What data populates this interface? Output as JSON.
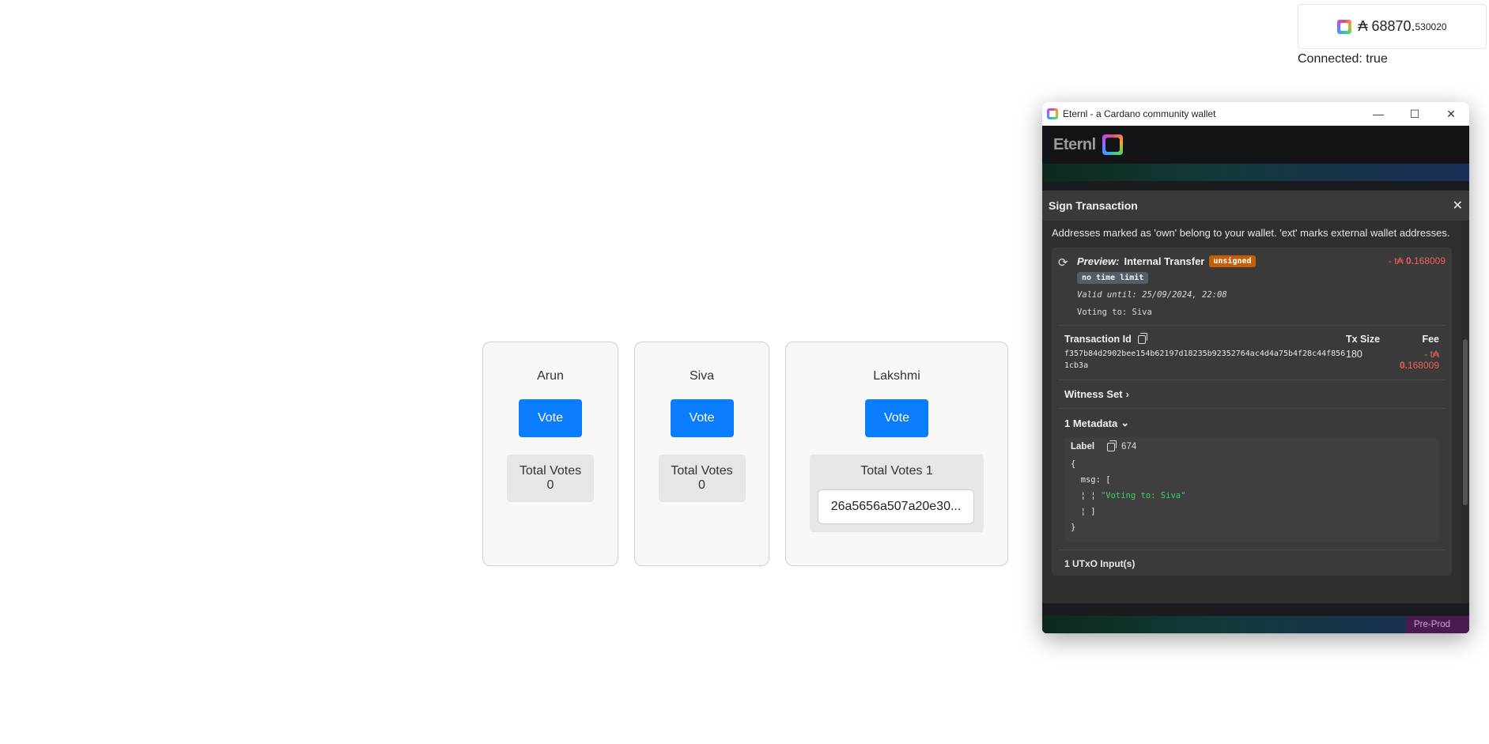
{
  "wallet_badge": {
    "balance_main": "₳ 68870.",
    "balance_small": "530020",
    "icon": "eternl-logo-icon"
  },
  "connection": {
    "status": "Connected: true"
  },
  "candidates": [
    {
      "name": "Arun",
      "vote_label": "Vote",
      "total_votes": "Total Votes 0"
    },
    {
      "name": "Siva",
      "vote_label": "Vote",
      "total_votes": "Total Votes 0"
    },
    {
      "name": "Lakshmi",
      "vote_label": "Vote",
      "total_votes": "Total Votes 1",
      "voter_hash": "26a5656a507a20e30..."
    }
  ],
  "wallet_window": {
    "title": "Eternl - a Cardano community wallet",
    "minimize": "—",
    "maximize": "☐",
    "close": "✕",
    "logo_text": "Eternl",
    "network_badge": "Pre-Prod",
    "sign_tx": {
      "heading": "Sign Transaction",
      "close": "✕",
      "intro": "Addresses marked as 'own' belong to your wallet. 'ext' marks external wallet addresses.",
      "preview": {
        "label_italic": "Preview:",
        "label": "Internal Transfer",
        "status": "unsigned",
        "time_badge": "no time limit",
        "valid_until": "Valid until: 25/09/2024, 22:08",
        "voting_to": "Voting to: Siva",
        "amount_prefix": "- t₳ ",
        "amount_int": "0.",
        "amount_dec": "168009"
      },
      "tx": {
        "id_label": "Transaction Id",
        "id_value": "f357b84d2902bee154b62197d18235b92352764ac4d4a75b4f28c44f8561cb3a",
        "size_label": "Tx Size",
        "size_value": "180",
        "fee_label": "Fee",
        "fee_prefix": "- t₳ ",
        "fee_int": "0.",
        "fee_dec": "168009"
      },
      "witness_label": "Witness Set",
      "metadata": {
        "heading": "1 Metadata",
        "label_key": "Label",
        "label_value": "674",
        "line1": "{",
        "line2": "  msg: [",
        "line3_prefix": "  ¦ ¦ ",
        "line3_str": "\"Voting to: Siva\"",
        "line4": "  ¦ ]",
        "line5": "}"
      },
      "utxo_label": "1 UTxO Input(s)"
    }
  }
}
